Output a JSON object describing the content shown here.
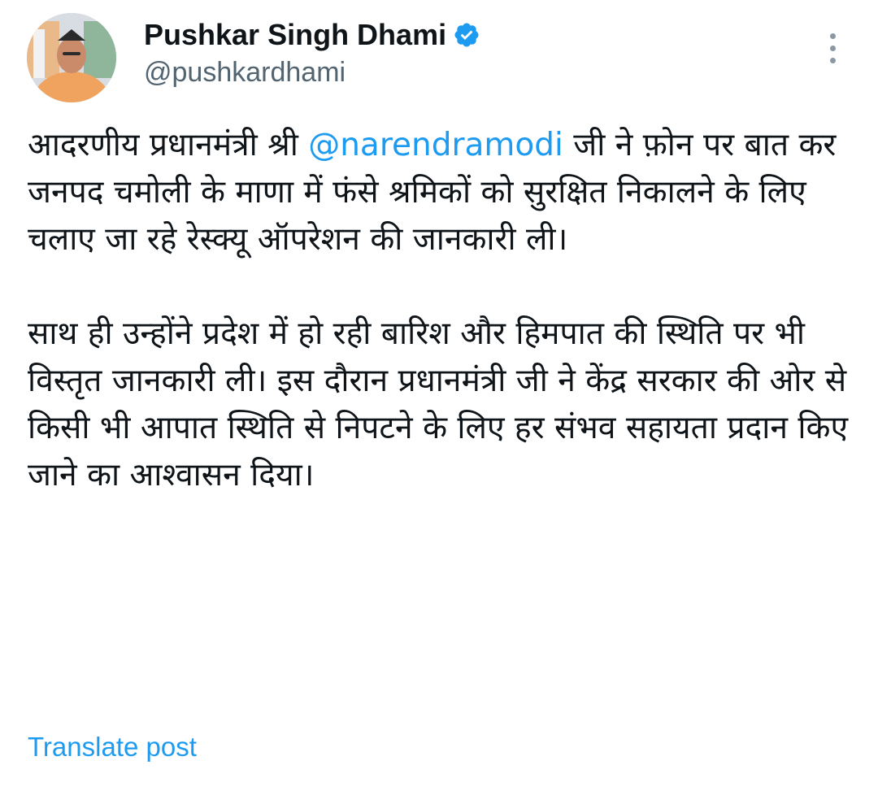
{
  "author": {
    "display_name": "Pushkar Singh Dhami",
    "handle": "@pushkardhami",
    "verified_icon": "verified-badge-icon",
    "avatar": "avatar"
  },
  "colors": {
    "accent": "#1d9bf0",
    "text": "#0f1419",
    "secondary_text": "#536471"
  },
  "more_menu_icon": "more-vertical-icon",
  "tweet": {
    "para1_prefix": "आदरणीय प्रधानमंत्री श्री ",
    "mention": "@narendramodi",
    "para1_suffix": " जी ने फ़ोन पर बात कर जनपद चमोली के माणा में फंसे श्रमिकों को सुरक्षित निकालने के लिए चलाए जा रहे रेस्क्यू ऑपरेशन की जानकारी ली।",
    "para2": "साथ ही उन्होंने प्रदेश में हो रही बारिश और हिमपात की स्थिति पर भी विस्तृत जानकारी ली। इस दौरान प्रधानमंत्री जी ने केंद्र सरकार की ओर से किसी भी आपात स्थिति से निपटने के लिए हर संभव सहायता प्रदान किए जाने का आश्वासन दिया।"
  },
  "translate_label": "Translate post"
}
